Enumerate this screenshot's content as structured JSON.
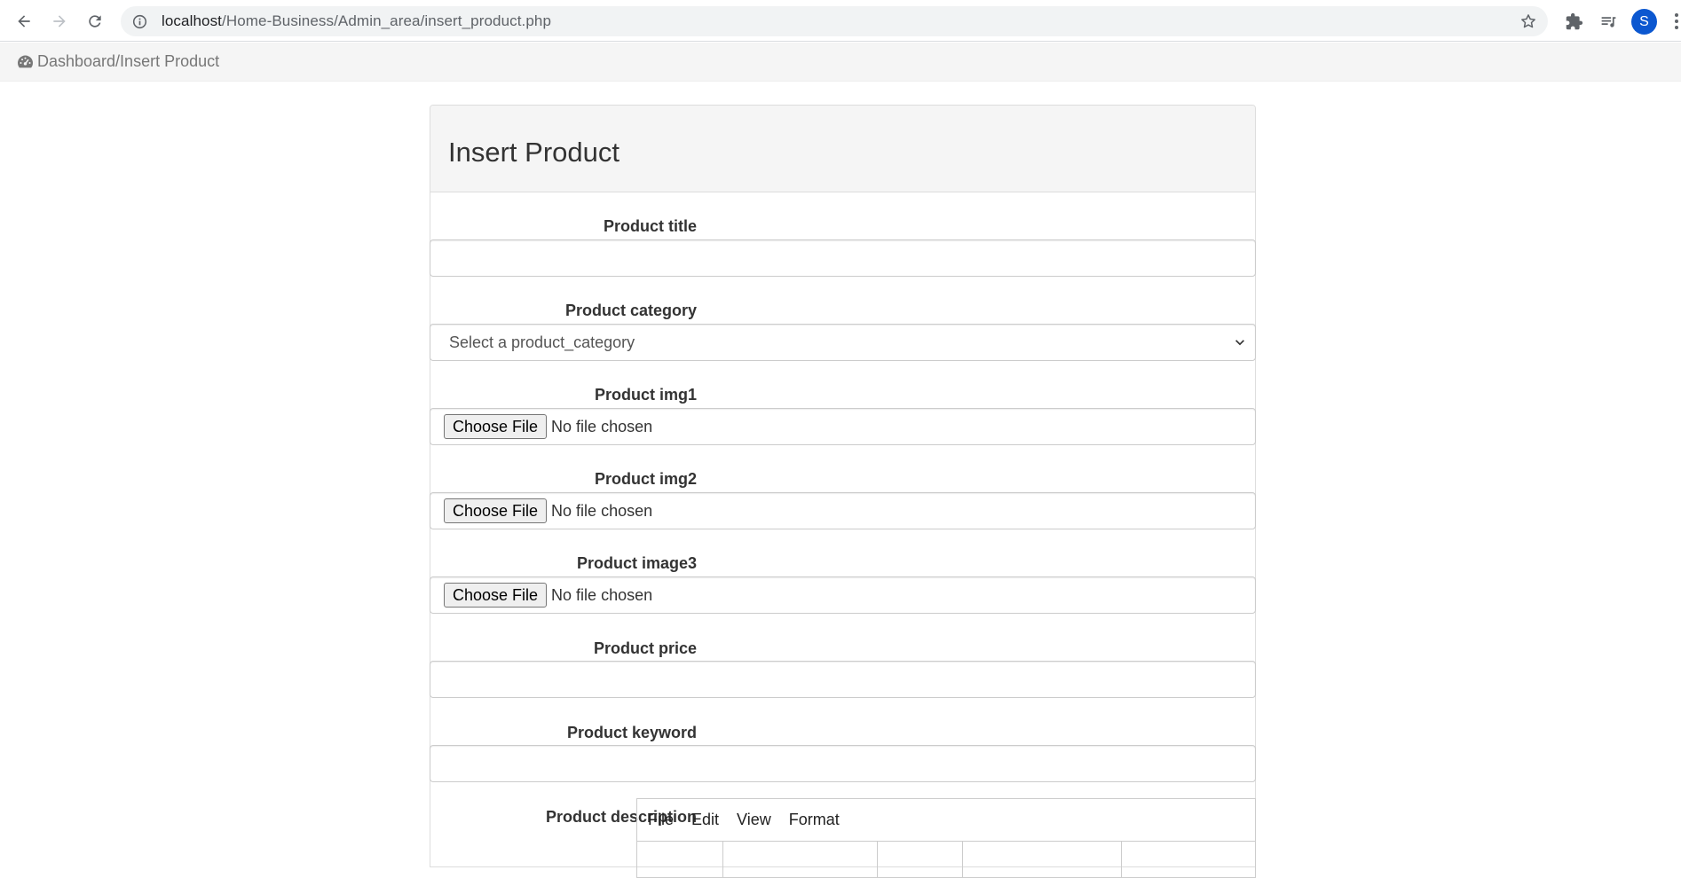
{
  "browser": {
    "url_host": "localhost",
    "url_path": "/Home-Business/Admin_area/insert_product.php",
    "avatar_letter": "S",
    "accent": "#0b57d0"
  },
  "breadcrumb": {
    "icon": "dashboard-icon",
    "text": "Dashboard/Insert Product"
  },
  "panel": {
    "title": "Insert Product"
  },
  "form": {
    "title_label": "Product title",
    "category_label": "Product category",
    "category_selected": "Select a product_category",
    "img1_label": "Product img1",
    "img2_label": "Product img2",
    "img3_label": "Product image3",
    "price_label": "Product price",
    "keyword_label": "Product keyword",
    "description_label": "Product description",
    "choose_file": "Choose File",
    "no_file": "No file chosen"
  },
  "editor": {
    "menu": [
      "File",
      "Edit",
      "View",
      "Format"
    ]
  }
}
